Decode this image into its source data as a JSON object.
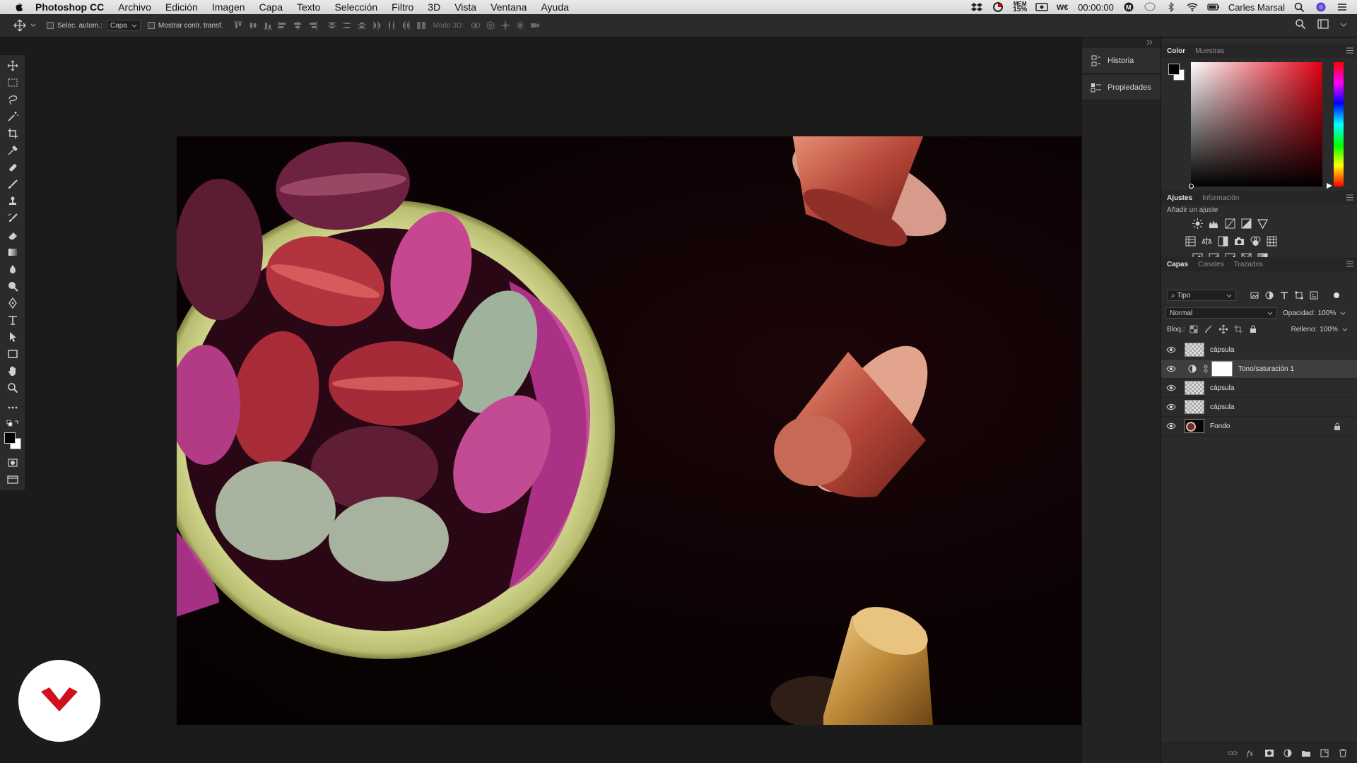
{
  "menubar": {
    "app_name": "Photoshop CC",
    "items": [
      "Archivo",
      "Edición",
      "Imagen",
      "Capa",
      "Texto",
      "Selección",
      "Filtro",
      "3D",
      "Vista",
      "Ventana",
      "Ayuda"
    ],
    "mem_label": "MEM",
    "mem_value": "15%",
    "clock": "00:00:00",
    "user": "Carles Marsal",
    "icons": [
      "apple-icon",
      "dropbox-icon",
      "memory-icon",
      "screen-record-icon",
      "wacom-icon",
      "m-badge-icon",
      "chat-icon",
      "bluetooth-icon",
      "wifi-icon",
      "battery-icon",
      "search-icon",
      "siri-icon",
      "menu-icon"
    ]
  },
  "options": {
    "auto_select_label": "Selec. autom.:",
    "auto_select_value": "Capa",
    "show_transform_label": "Mostrar contr. transf.",
    "mode3d_label": "Modo 3D:"
  },
  "toolbar": {
    "tools": [
      "move-tool-icon",
      "marquee-tool-icon",
      "lasso-tool-icon",
      "magic-wand-tool-icon",
      "crop-tool-icon",
      "eyedropper-tool-icon",
      "healing-brush-tool-icon",
      "brush-tool-icon",
      "clone-stamp-tool-icon",
      "history-brush-tool-icon",
      "eraser-tool-icon",
      "gradient-tool-icon",
      "blur-tool-icon",
      "dodge-tool-icon",
      "pen-tool-icon",
      "type-tool-icon",
      "path-selection-tool-icon",
      "rectangle-tool-icon",
      "hand-tool-icon",
      "zoom-tool-icon",
      "more-tools-icon"
    ]
  },
  "collapsed_panels": {
    "history": "Historia",
    "properties": "Propiedades"
  },
  "color_panel": {
    "tabs": [
      "Color",
      "Muestras"
    ],
    "foreground": "#000000",
    "background": "#ffffff",
    "field_hue": "#e00012"
  },
  "adjustments_panel": {
    "tabs": [
      "Ajustes",
      "Información"
    ],
    "add_label": "Añadir un ajuste"
  },
  "layers_panel": {
    "tabs": [
      "Capas",
      "Canales",
      "Trazados"
    ],
    "filter_kind": "Tipo",
    "blend_mode": "Normal",
    "opacity_label": "Opacidad:",
    "opacity_value": "100%",
    "lock_label": "Bloq.:",
    "fill_label": "Relleno:",
    "fill_value": "100%",
    "layers": [
      {
        "name": "cápsula",
        "selected": false
      },
      {
        "name": "Tono/saturación 1",
        "selected": true
      },
      {
        "name": "cápsula",
        "selected": false
      },
      {
        "name": "cápsula",
        "selected": false
      },
      {
        "name": "Fondo",
        "selected": false
      }
    ]
  }
}
